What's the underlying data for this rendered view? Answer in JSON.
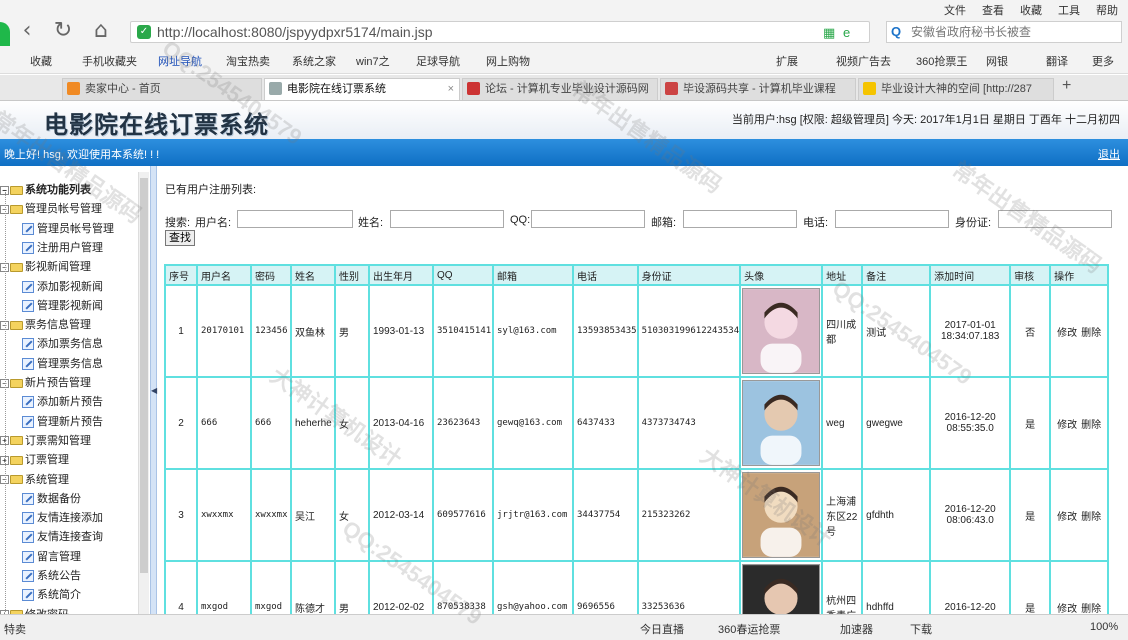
{
  "browser": {
    "menu": [
      "文件",
      "查看",
      "收藏",
      "工具",
      "帮助"
    ],
    "url": "http://localhost:8080/jspyydpxr5174/main.jsp",
    "search_placeholder": "安徽省政府秘书长被查",
    "bookmarks": [
      "收藏",
      "手机收藏夹",
      "网址导航",
      "淘宝热卖",
      "系统之家",
      "win7之",
      "足球导航",
      "网上购物",
      "扩展",
      "视频广告去",
      "360抢票王",
      "网银",
      "翻译",
      "更多"
    ],
    "tabs": [
      {
        "label": "卖家中心 - 首页"
      },
      {
        "label": "电影院在线订票系统"
      },
      {
        "label": "论坛 - 计算机专业毕业设计源码网"
      },
      {
        "label": "毕设源码共享 - 计算机毕业课程"
      },
      {
        "label": "毕业设计大神的空间 [http://287"
      }
    ]
  },
  "app": {
    "title": "电影院在线订票系统",
    "user_info": "当前用户:hsg [权限: 超级管理员] 今天: 2017年1月1日 星期日 丁酉年 十二月初四",
    "welcome": "晚上好! hsg, 欢迎使用本系统! ! !",
    "logout": "退出"
  },
  "sidebar": {
    "root": "系统功能列表",
    "groups": [
      {
        "label": "管理员帐号管理",
        "items": [
          "管理员帐号管理",
          "注册用户管理"
        ]
      },
      {
        "label": "影视新闻管理",
        "items": [
          "添加影视新闻",
          "管理影视新闻"
        ]
      },
      {
        "label": "票务信息管理",
        "items": [
          "添加票务信息",
          "管理票务信息"
        ]
      },
      {
        "label": "新片预告管理",
        "items": [
          "添加新片预告",
          "管理新片预告"
        ]
      },
      {
        "label": "订票需知管理",
        "items": []
      },
      {
        "label": "订票管理",
        "items": []
      },
      {
        "label": "系统管理",
        "items": [
          "数据备份",
          "友情连接添加",
          "友情连接查询",
          "留言管理",
          "系统公告",
          "系统简介"
        ]
      },
      {
        "label": "修改密码",
        "items": []
      }
    ]
  },
  "content": {
    "list_title": "已有用户注册列表:",
    "search": {
      "prefix": "搜索:",
      "labels": [
        "用户名:",
        "姓名:",
        "QQ:",
        "邮箱:",
        "电话:",
        "身份证:"
      ],
      "button": "查找"
    },
    "table": {
      "columns": [
        "序号",
        "用户名",
        "密码",
        "姓名",
        "性别",
        "出生年月",
        "QQ",
        "邮箱",
        "电话",
        "身份证",
        "头像",
        "地址",
        "备注",
        "添加时间",
        "审核",
        "操作"
      ],
      "rows": [
        {
          "no": "1",
          "username": "20170101",
          "password": "123456",
          "name": "双鱼林",
          "gender": "男",
          "birth": "1993-01-13",
          "qq": "3510415141",
          "email": "syl@163.com",
          "phone": "13593853435",
          "idcard": "510303199612243534",
          "address": "四川成都",
          "remark": "测试",
          "added": "2017-01-01 18:34:07.183",
          "audit": "否",
          "edit": "修改",
          "del": "删除"
        },
        {
          "no": "2",
          "username": "666",
          "password": "666",
          "name": "heherhe",
          "gender": "女",
          "birth": "2013-04-16",
          "qq": "23623643",
          "email": "gewq@163.com",
          "phone": "6437433",
          "idcard": "4373734743",
          "address": "weg",
          "remark": "gwegwe",
          "added": "2016-12-20 08:55:35.0",
          "audit": "是",
          "edit": "修改",
          "del": "删除"
        },
        {
          "no": "3",
          "username": "xwxxmx",
          "password": "xwxxmx",
          "name": "吴江",
          "gender": "女",
          "birth": "2012-03-14",
          "qq": "609577616",
          "email": "jrjtr@163.com",
          "phone": "34437754",
          "idcard": "215323262",
          "address": "上海浦东区22号",
          "remark": "gfdhth",
          "added": "2016-12-20 08:06:43.0",
          "audit": "是",
          "edit": "修改",
          "del": "删除"
        },
        {
          "no": "4",
          "username": "mxgod",
          "password": "mxgod",
          "name": "陈德才",
          "gender": "男",
          "birth": "2012-02-02",
          "qq": "870538338",
          "email": "gsh@yahoo.com",
          "phone": "9696556",
          "idcard": "33253636",
          "address": "杭州四季青广",
          "remark": "hdhffd",
          "added": "2016-12-20",
          "audit": "是",
          "edit": "修改",
          "del": "删除"
        }
      ]
    }
  },
  "statusbar": {
    "left": "特卖",
    "items": [
      "今日直播",
      "360春运抢票",
      "加速器",
      "下载",
      "100%"
    ]
  },
  "watermarks": [
    "常年出售精品源码",
    "QQ:2545404579",
    "大神计算机设计",
    "QQ:2545404579",
    "常年出售精品源码",
    "大神计算机设计",
    "QQ:2545404579",
    "常年出售精品源码"
  ]
}
